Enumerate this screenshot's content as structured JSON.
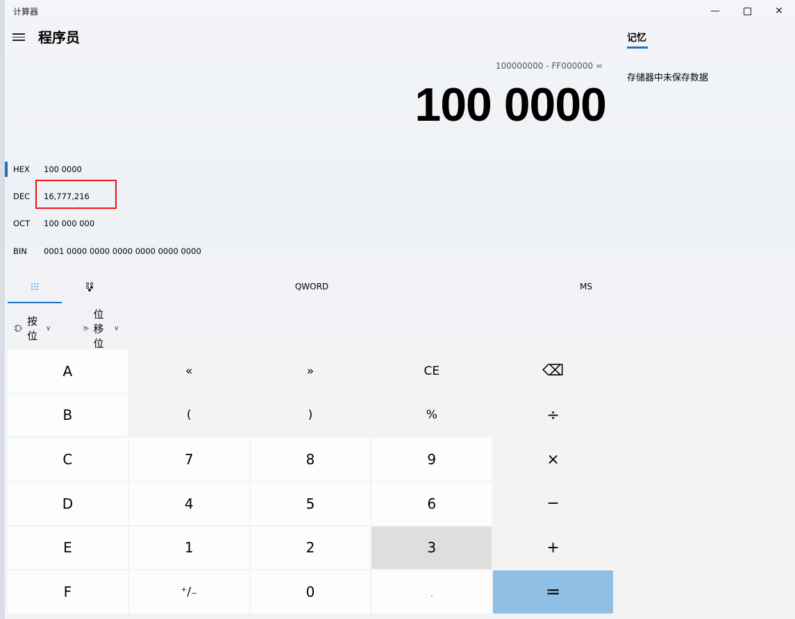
{
  "window": {
    "title": "计算器"
  },
  "header": {
    "mode": "程序员"
  },
  "display": {
    "expression": "100000000 - FF000000 =",
    "result": "100 0000"
  },
  "radix": [
    {
      "name": "HEX",
      "value": "100 0000",
      "selected": true
    },
    {
      "name": "DEC",
      "value": "16,777,216",
      "selected": false
    },
    {
      "name": "OCT",
      "value": "100 000 000",
      "selected": false
    },
    {
      "name": "BIN",
      "value": "0001 0000 0000 0000 0000 0000 0000",
      "selected": false
    }
  ],
  "tabs": {
    "word_size": "QWORD",
    "memory_store": "MS"
  },
  "operations": {
    "bitwise": "按位",
    "bit_shift": "位移位"
  },
  "keypad": {
    "row1": [
      "A",
      "«",
      "»",
      "CE",
      "⌫"
    ],
    "row2": [
      "B",
      "(",
      ")",
      "%",
      "÷"
    ],
    "row3": [
      "C",
      "7",
      "8",
      "9",
      "×"
    ],
    "row4": [
      "D",
      "4",
      "5",
      "6",
      "−"
    ],
    "row5": [
      "E",
      "1",
      "2",
      "3",
      "+"
    ],
    "row6": [
      "F",
      "⁺∕₋",
      "0",
      ".",
      "="
    ]
  },
  "memory": {
    "title": "记忆",
    "empty_text": "存储器中未保存数据"
  },
  "colors": {
    "accent": "#1a73c6",
    "equals": "#8fbfe5",
    "highlight": "#ee1111"
  }
}
